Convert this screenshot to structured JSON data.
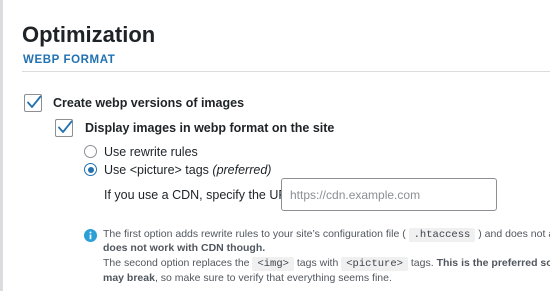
{
  "page": {
    "title": "Optimization",
    "section": "WEBP FORMAT"
  },
  "options": {
    "create_webp": {
      "label": "Create webp versions of images",
      "checked": true
    },
    "display_webp": {
      "label": "Display images in webp format on the site",
      "checked": true
    }
  },
  "method": {
    "rewrite": {
      "label": "Use rewrite rules",
      "selected": false
    },
    "picture": {
      "label_prefix": "Use <picture> tags",
      "label_suffix": "(preferred)",
      "selected": true
    }
  },
  "cdn": {
    "label": "If you use a CDN, specify the URL:",
    "value": "",
    "placeholder": "https://cdn.example.com"
  },
  "note": {
    "line1_a": "The first option adds rewrite rules to your site’s configuration file (",
    "line1_code": ".htaccess",
    "line1_b": ") and does not alter yo",
    "line2_bold": "does not work with CDN though.",
    "line3_a": "The second option replaces the",
    "line3_code1": "<img>",
    "line3_b": "tags with",
    "line3_code2": "<picture>",
    "line3_c": "tags.",
    "line3_bold": "This is the preferred solution",
    "line4_bold": "may break",
    "line4_rest": ", so make sure to verify that everything seems fine."
  },
  "colors": {
    "accent": "#2271b1",
    "text": "#1d2327",
    "muted": "#50575e",
    "border": "#8c8f94",
    "divider": "#dcdcde"
  },
  "icons": {
    "checkbox_check": "checkmark-icon",
    "info": "info-icon"
  }
}
